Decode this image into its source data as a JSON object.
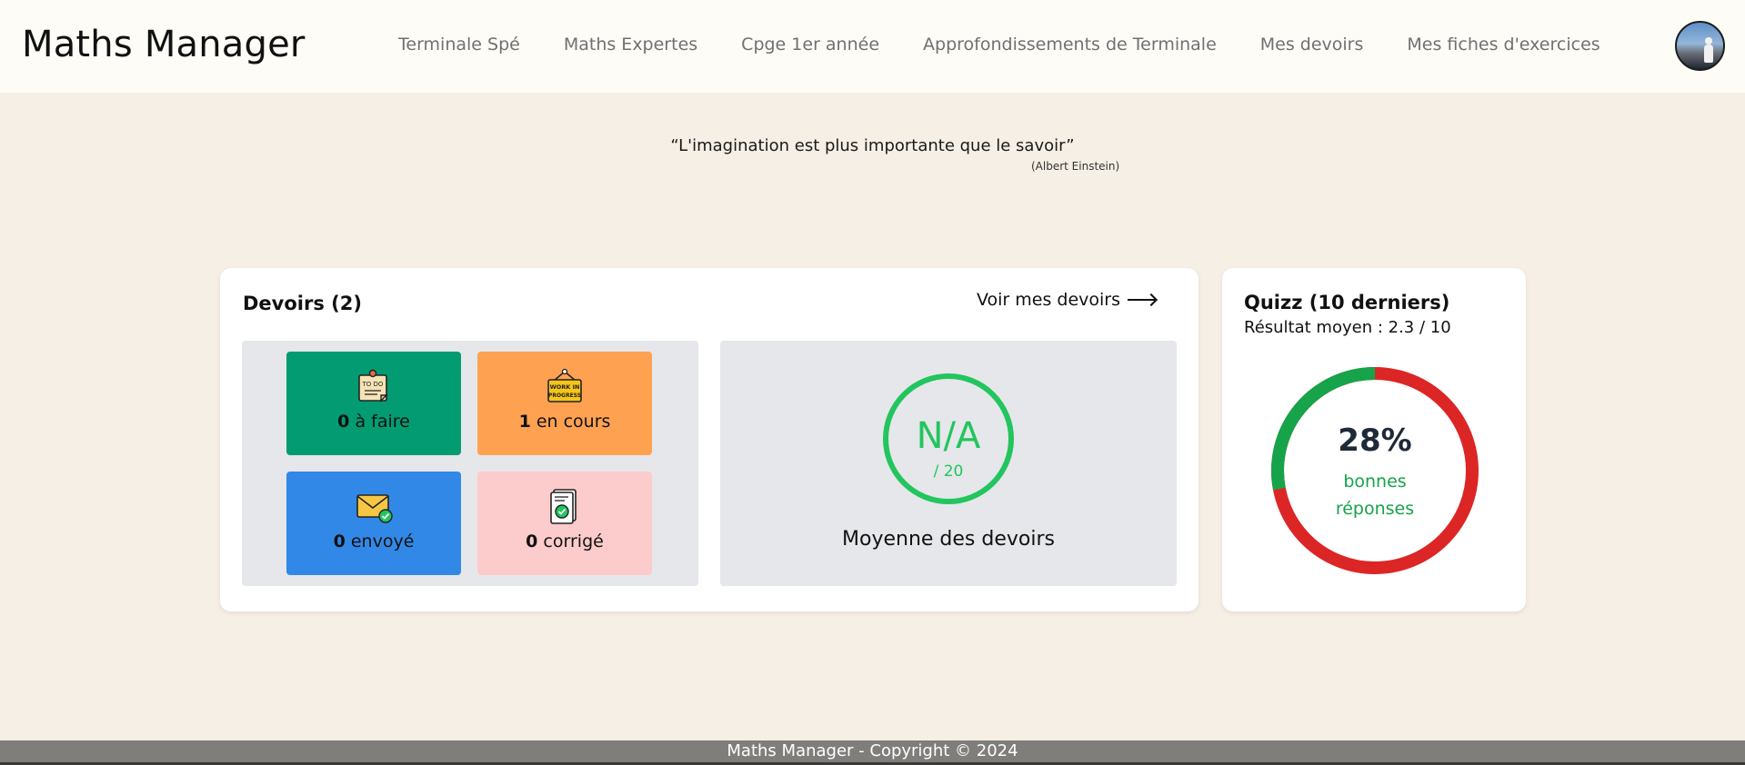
{
  "header": {
    "brand": "Maths Manager",
    "nav": [
      {
        "label": "Terminale Spé"
      },
      {
        "label": "Maths Expertes"
      },
      {
        "label": "Cpge 1er année"
      },
      {
        "label": "Approfondissements de Terminale"
      },
      {
        "label": "Mes devoirs"
      },
      {
        "label": "Mes fiches d'exercices"
      }
    ]
  },
  "quote": {
    "text": "“L'imagination est plus importante que le savoir”",
    "author": "(Albert Einstein)"
  },
  "devoirs": {
    "title": "Devoirs (2)",
    "link_label": "Voir mes devoirs",
    "tiles": [
      {
        "count": "0",
        "label": " à faire",
        "icon": "todo-note-icon",
        "color": "#039b72"
      },
      {
        "count": "1",
        "label": " en cours",
        "icon": "work-in-progress-sign-icon",
        "color": "#fea252"
      },
      {
        "count": "0",
        "label": " envoyé",
        "icon": "envelope-check-icon",
        "color": "#3288e6"
      },
      {
        "count": "0",
        "label": " corrigé",
        "icon": "document-check-icon",
        "color": "#fccbcb"
      }
    ],
    "grade": {
      "value": "N/A",
      "scale": "/ 20",
      "caption": "Moyenne des devoirs",
      "color": "#22c55e"
    }
  },
  "quizz": {
    "title": "Quizz (10 derniers)",
    "subtitle": "Résultat moyen : 2.3 / 10",
    "percent": "28%",
    "percent_value": 28,
    "label_line1": "bonnes",
    "label_line2": "réponses",
    "good_color": "#16a34a",
    "bad_color": "#dc2626"
  },
  "footer": {
    "text": "Maths Manager - Copyright © 2024"
  }
}
